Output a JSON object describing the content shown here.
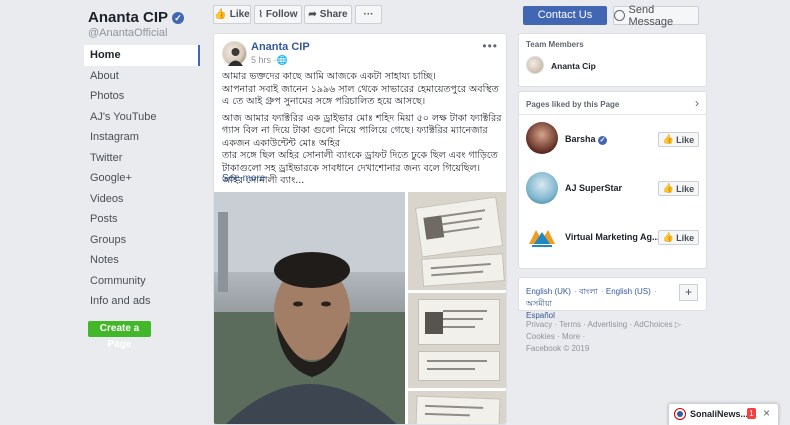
{
  "page": {
    "name": "Ananta CIP",
    "handle": "@AnantaOfficial",
    "verified_icon": "verified-check-icon"
  },
  "nav": [
    {
      "label": "Home",
      "active": true
    },
    {
      "label": "About"
    },
    {
      "label": "Photos"
    },
    {
      "label": "AJ's YouTube"
    },
    {
      "label": "Instagram"
    },
    {
      "label": "Twitter"
    },
    {
      "label": "Google+"
    },
    {
      "label": "Videos"
    },
    {
      "label": "Posts"
    },
    {
      "label": "Groups"
    },
    {
      "label": "Notes"
    },
    {
      "label": "Community"
    },
    {
      "label": "Info and ads"
    }
  ],
  "create_page": "Create a Page",
  "actions": {
    "like": "Like",
    "follow": "Follow",
    "share": "Share",
    "more": "···",
    "contact": "Contact Us",
    "send_message": "Send Message"
  },
  "post": {
    "author": "Ananta CIP",
    "time": "5 hrs",
    "paragraphs": [
      "আমার ভক্তদের কাছে আমি আজকে একটা সাহায্য চাচ্ছি।\nআপনারা সবাই জানেন ১৯৯৬ সাল থেকে সাভারের হেমায়েতপুরে অবস্থিত এ তে আই গ্রুপ সুনামের সঙ্গে পরিচালিত হয়ে আসছে।",
      "আজ আমার ফ্যাক্টরির এক ড্রাইভার মোঃ শহিদ মিয়া ৫০ লক্ষ টাকা ফ্যাক্টরির গ্যাস বিল না দিয়ে টাকা গুলো নিয়ে পালিয়ে গেছে। ফ্যাক্টরির ম্যানেজার একজন একাউন্টেন্ট মোঃ অহির\nতার সঙ্গে ছিল অহির সোনালী ব্যাংকে ড্রাফট দিতে ঢুকে ছিল এবং গাড়িতে টাকাগুলো সহ ড্রাইভারকে সাবধানে দেখাশোনার জন্য বলে গিয়েছিল। অহির সোনালী ব্যাং..."
    ],
    "see_more": "See more"
  },
  "sidebar": {
    "team_title": "Team Members",
    "team_member": "Ananta Cip",
    "liked_title": "Pages liked by this Page",
    "liked_pages": [
      {
        "name": "Barsha",
        "verified": true,
        "button": "Like"
      },
      {
        "name": "AJ SuperStar",
        "verified": false,
        "button": "Like"
      },
      {
        "name": "Virtual Marketing Ag...",
        "verified": false,
        "button": "Like"
      }
    ],
    "languages": [
      "English (UK)",
      "বাংলা",
      "English (US)",
      "অসমীয়া",
      "Español"
    ],
    "add_language": "+",
    "footer_links": [
      "Privacy",
      "Terms",
      "Advertising",
      "AdChoices",
      "Cookies",
      "More"
    ],
    "copyright": "Facebook © 2019"
  },
  "chat": {
    "name": "SonaliNews...",
    "badge": "1",
    "close": "×"
  },
  "colors": {
    "brand": "#4267b2",
    "link": "#365899",
    "green": "#42b72a",
    "badge": "#fa3e3e"
  }
}
